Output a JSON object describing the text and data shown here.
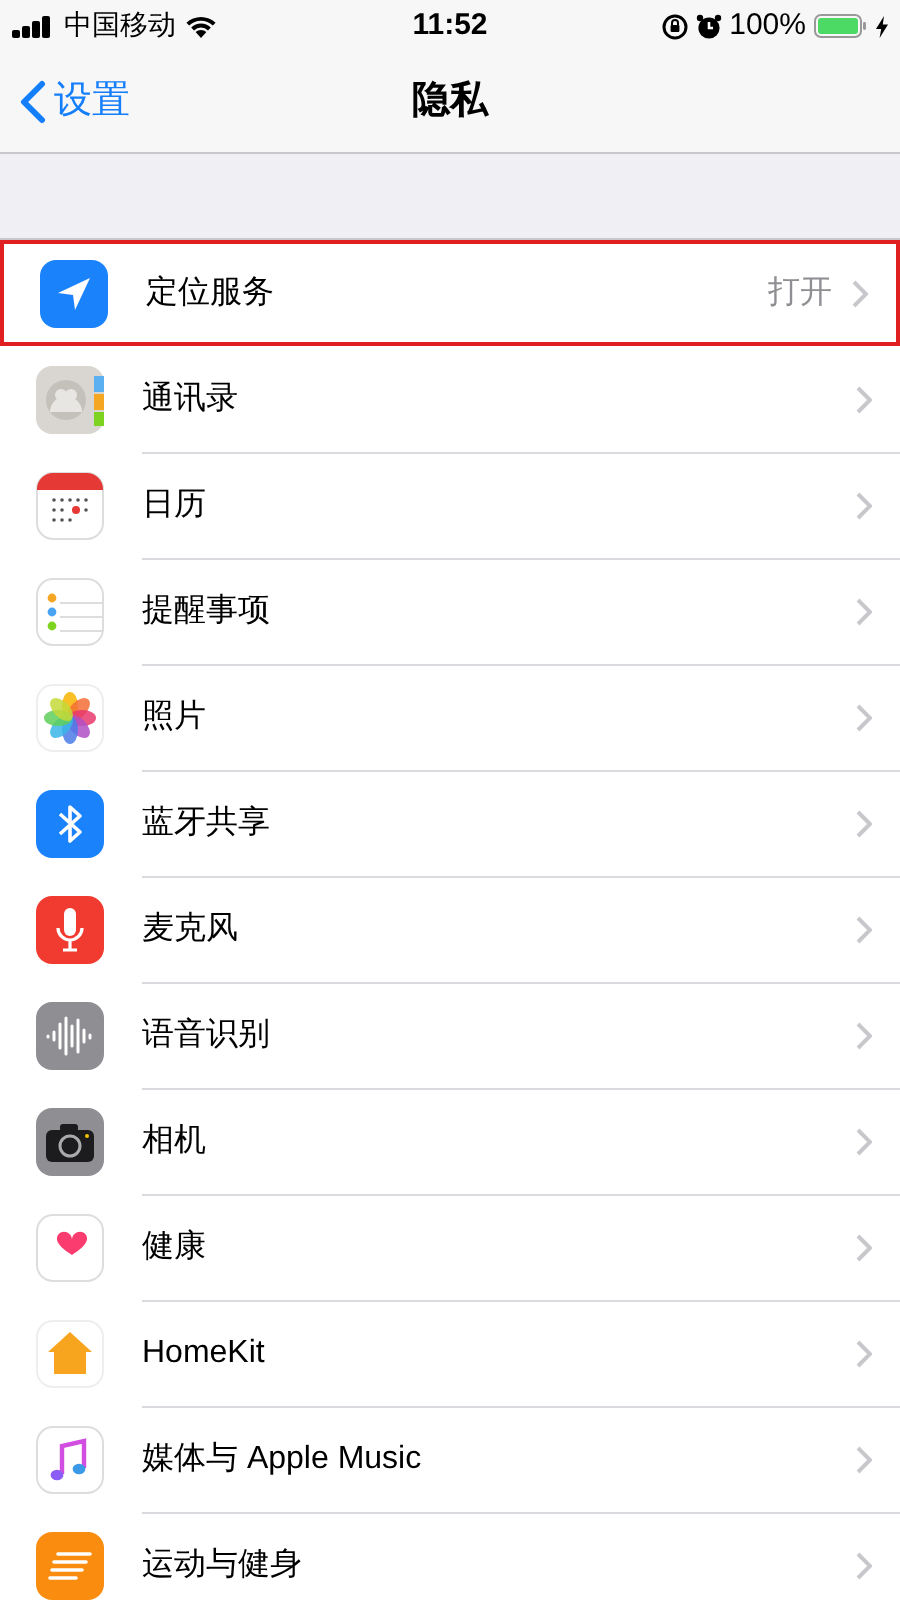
{
  "status_bar": {
    "carrier": "中国移动",
    "time": "11:52",
    "battery": "100%"
  },
  "nav": {
    "back": "设置",
    "title": "隐私"
  },
  "items": [
    {
      "label": "定位服务",
      "value": "打开",
      "highlighted": true
    },
    {
      "label": "通讯录",
      "highlighted": false
    },
    {
      "label": "日历",
      "highlighted": false
    },
    {
      "label": "提醒事项",
      "highlighted": false
    },
    {
      "label": "照片",
      "highlighted": false
    },
    {
      "label": "蓝牙共享",
      "highlighted": false
    },
    {
      "label": "麦克风",
      "highlighted": false
    },
    {
      "label": "语音识别",
      "highlighted": false
    },
    {
      "label": "相机",
      "highlighted": false
    },
    {
      "label": "健康",
      "highlighted": false
    },
    {
      "label": "HomeKit",
      "highlighted": false
    },
    {
      "label": "媒体与 Apple Music",
      "highlighted": false
    },
    {
      "label": "运动与健身",
      "highlighted": false
    }
  ]
}
